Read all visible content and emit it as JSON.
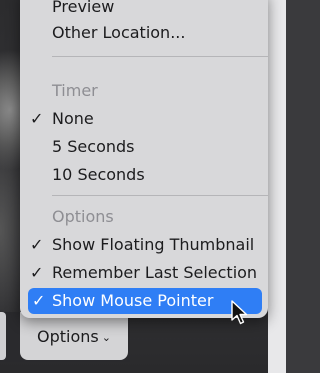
{
  "menu": {
    "items": [
      {
        "label": "Preview",
        "checked": false
      },
      {
        "label": "Other Location...",
        "checked": false
      }
    ],
    "timer": {
      "header": "Timer",
      "options": [
        {
          "label": "None",
          "checked": true
        },
        {
          "label": "5 Seconds",
          "checked": false
        },
        {
          "label": "10 Seconds",
          "checked": false
        }
      ]
    },
    "options": {
      "header": "Options",
      "options": [
        {
          "label": "Show Floating Thumbnail",
          "checked": true
        },
        {
          "label": "Remember Last Selection",
          "checked": true
        },
        {
          "label": "Show Mouse Pointer",
          "checked": true,
          "highlighted": true
        }
      ]
    },
    "checkmark": "✓"
  },
  "toolbar": {
    "options_label": "Options",
    "chevron": "⌄"
  },
  "colors": {
    "menu_bg": "#d8d8da",
    "highlight": "#2f7ef5",
    "header_text": "#8e8e93"
  }
}
